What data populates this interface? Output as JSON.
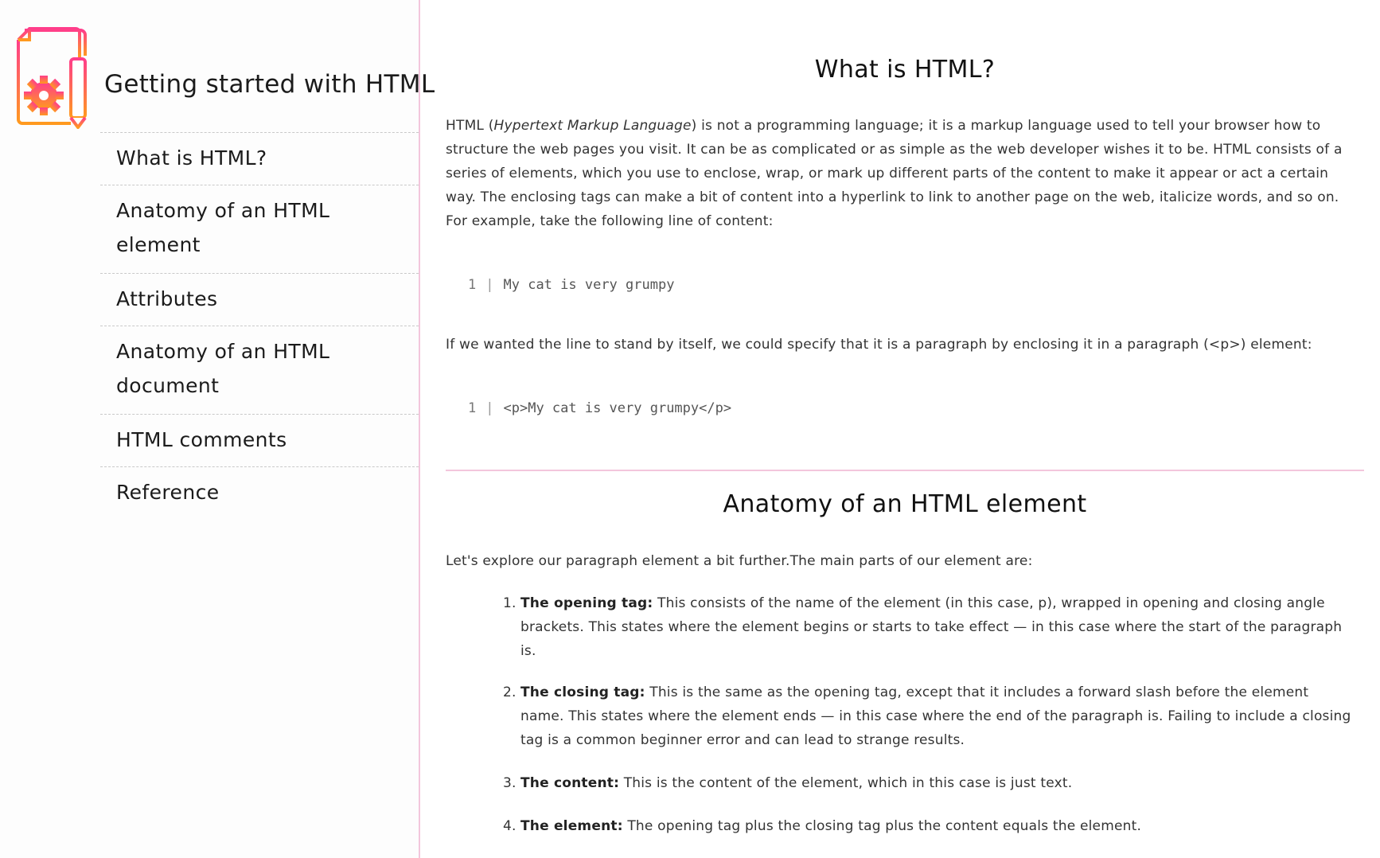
{
  "sidebar": {
    "title": "Getting started with HTML",
    "logo_icon": "document-gear-pencil-icon",
    "items": [
      {
        "label": "What is HTML?"
      },
      {
        "label_line1": "Anatomy of an HTML",
        "label_line2": "element"
      },
      {
        "label": "Attributes"
      },
      {
        "label_line1": "Anatomy of an HTML",
        "label_line2": "document"
      },
      {
        "label": "HTML comments"
      },
      {
        "label": "Reference"
      }
    ]
  },
  "main": {
    "section1": {
      "title": "What is HTML?",
      "intro_prefix": "HTML (",
      "intro_italic": "Hypertext Markup Language",
      "intro_rest": ") is not a programming language; it is a markup language used to tell your browser how to structure the web pages you visit. It can be as complicated or as simple as the web developer wishes it to be. HTML consists of a series of elements, which you use to enclose, wrap, or mark up different parts of the content to make it appear or act a certain way. The enclosing tags can make a bit of content into a hyperlink to link to another page on the web, italicize words, and so on. For example, take the following line of content:",
      "code1_line_number": "1",
      "code1": "My cat is very grumpy",
      "para2": "If we wanted the line to stand by itself, we could specify that it is a paragraph by enclosing it in a paragraph (<p>) element:",
      "code2_line_number": "1",
      "code2": "<p>My cat is very grumpy</p>"
    },
    "section2": {
      "title": "Anatomy of an HTML element",
      "intro": "Let's explore our paragraph element a bit further.The main parts of our element are:",
      "parts": [
        {
          "number": "1.",
          "term": "The opening tag:",
          "text": " This consists of the name of the element (in this case, p), wrapped in opening and closing angle brackets. This states where the element begins or starts to take effect — in this case where the start of the paragraph is."
        },
        {
          "number": "2.",
          "term": "The closing tag:",
          "text": " This is the same as the opening tag, except that it includes a forward slash before the element name. This states where the element ends — in this case where the end of the paragraph is. Failing to include a closing tag is a common beginner error and can lead to strange results."
        },
        {
          "number": "3.",
          "term": "The content:",
          "text": " This is the content of the element, which in this case is just text."
        },
        {
          "number": "4.",
          "term": "The element:",
          "text": " The opening tag plus the closing tag plus the content equals the element."
        }
      ]
    }
  },
  "colors": {
    "accent_pink": "#f3c6dc",
    "logo_gradient_top": "#ff3d8b",
    "logo_gradient_bottom": "#ff9a1f"
  }
}
